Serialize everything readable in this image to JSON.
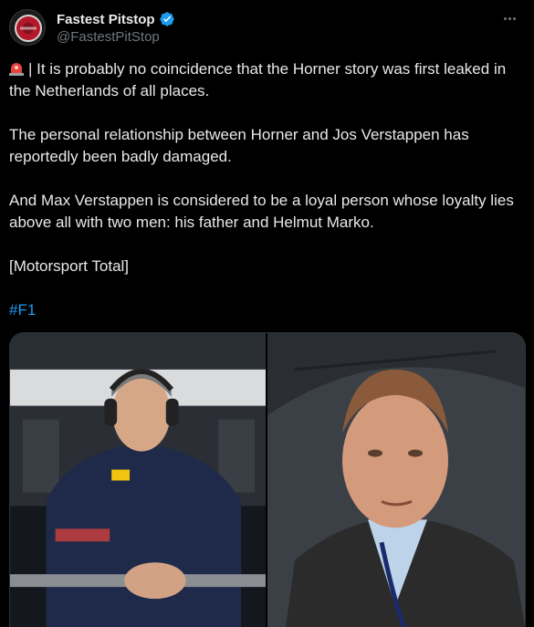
{
  "author": {
    "display_name": "Fastest Pitstop",
    "handle": "@FastestPitStop",
    "verified": true,
    "verified_color": "#1d9bf0",
    "avatar_icon": "fastest-pitstop-logo-icon"
  },
  "tweet": {
    "lead_icon": "rotating-light-emoji",
    "paragraphs": [
      "| It is probably no coincidence that the Horner story was first leaked in the Netherlands of all places.",
      "The personal relationship between Horner and Jos Verstappen has reportedly been badly damaged.",
      "And Max Verstappen is considered to be a loyal person whose loyalty lies above all with two men: his father and Helmut Marko.",
      "[Motorsport Total]"
    ],
    "hashtag": "#F1",
    "hashtag_color": "#1d9bf0"
  },
  "media": {
    "images": [
      {
        "subject": "Christian Horner in team shirt leaning on pit wall with headset"
      },
      {
        "subject": "Jos Verstappen portrait in leather jacket"
      }
    ]
  }
}
